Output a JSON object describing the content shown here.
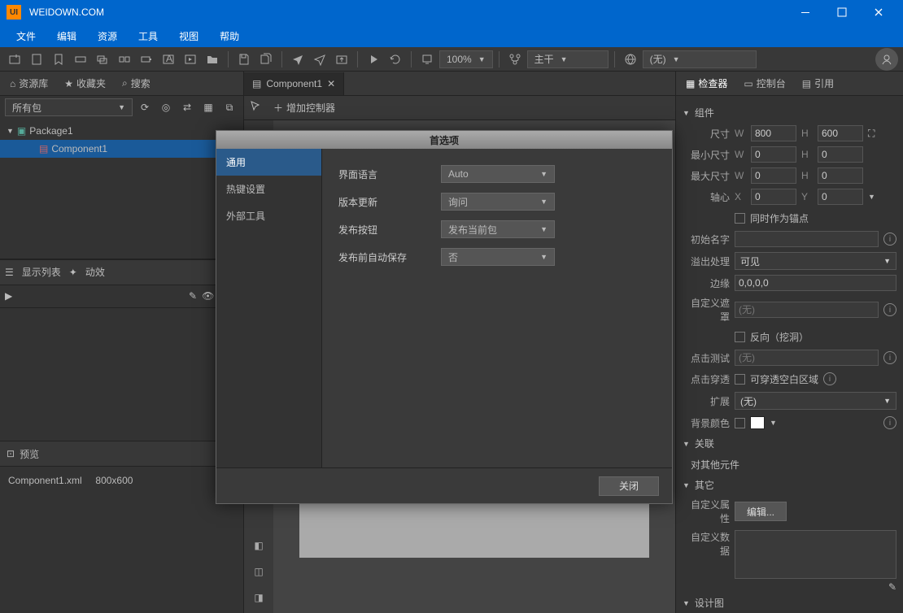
{
  "titlebar": {
    "logo": "UI",
    "title": "WEIDOWN.COM"
  },
  "menubar": [
    "文件",
    "编辑",
    "资源",
    "工具",
    "视图",
    "帮助"
  ],
  "toolbar": {
    "zoom": "100%",
    "branch": "主干",
    "locale": "(无)"
  },
  "left": {
    "tabs": {
      "library": "资源库",
      "favorites": "收藏夹",
      "search": "搜索"
    },
    "package_filter": "所有包",
    "tree": {
      "package": "Package1",
      "component": "Component1"
    },
    "list_tab": "显示列表",
    "effects_tab": "动效",
    "preview_tab": "预览",
    "preview_file": "Component1.xml",
    "preview_size": "800x600"
  },
  "center": {
    "tab": "Component1",
    "add_controller": "增加控制器"
  },
  "right": {
    "tabs": {
      "inspector": "检查器",
      "console": "控制台",
      "references": "引用"
    },
    "section_component": "组件",
    "labels": {
      "size": "尺寸",
      "min_size": "最小尺寸",
      "max_size": "最大尺寸",
      "pivot": "轴心",
      "pivot_anchor": "同时作为锚点",
      "init_name": "初始名字",
      "overflow": "溢出处理",
      "overflow_val": "可见",
      "margin": "边缘",
      "margin_val": "0,0,0,0",
      "mask": "自定义遮罩",
      "mask_val": "(无)",
      "reverse": "反向（挖洞）",
      "hit_test": "点击测试",
      "hit_test_val": "(无)",
      "hit_through": "点击穿透",
      "hit_through_label": "可穿透空白区域",
      "extend": "扩展",
      "extend_val": "(无)",
      "bg_color": "背景颜色",
      "relation": "关联",
      "relation_other": "对其他元件",
      "other": "其它",
      "custom_prop": "自定义属性",
      "edit_btn": "编辑...",
      "custom_data": "自定义数据",
      "design": "设计图"
    },
    "values": {
      "w": "800",
      "h": "600",
      "minw": "0",
      "minh": "0",
      "maxw": "0",
      "maxh": "0",
      "px": "0",
      "py": "0"
    }
  },
  "dialog": {
    "title": "首选项",
    "side": [
      "通用",
      "热键设置",
      "外部工具"
    ],
    "rows": [
      {
        "label": "界面语言",
        "value": "Auto"
      },
      {
        "label": "版本更新",
        "value": "询问"
      },
      {
        "label": "发布按钮",
        "value": "发布当前包"
      },
      {
        "label": "发布前自动保存",
        "value": "否"
      }
    ],
    "close": "关闭"
  }
}
